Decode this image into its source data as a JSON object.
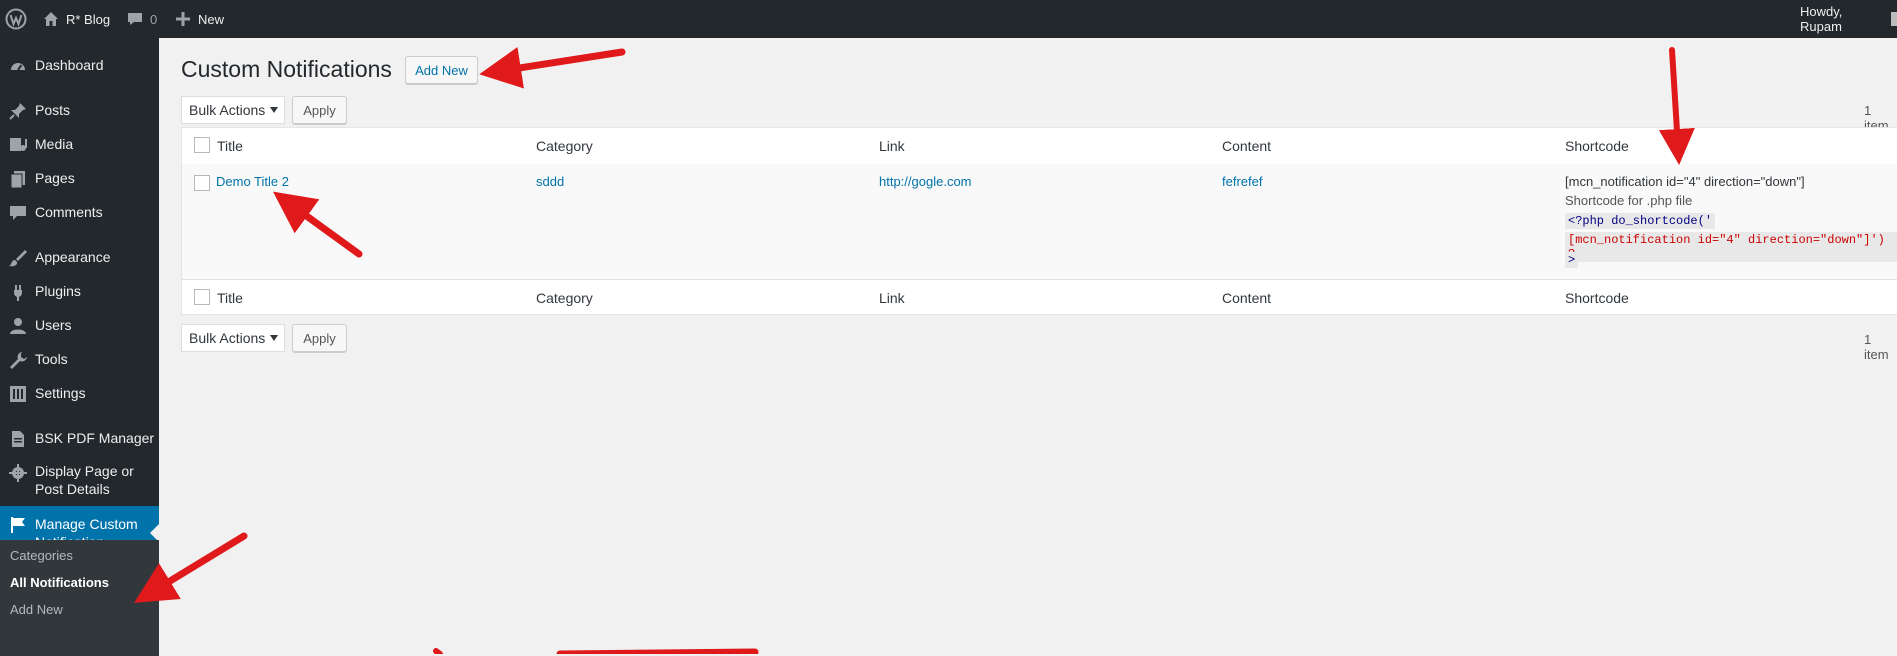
{
  "adminbar": {
    "site_name": "R* Blog",
    "comments_count": "0",
    "new_label": "New",
    "howdy": "Howdy, Rupam"
  },
  "sidebar": {
    "items": [
      {
        "label": "Dashboard",
        "icon": "dashboard-icon"
      },
      {
        "label": "Posts",
        "icon": "pushpin-icon"
      },
      {
        "label": "Media",
        "icon": "media-icon"
      },
      {
        "label": "Pages",
        "icon": "pages-icon"
      },
      {
        "label": "Comments",
        "icon": "comment-icon"
      },
      {
        "label": "Appearance",
        "icon": "paintbrush-icon"
      },
      {
        "label": "Plugins",
        "icon": "plug-icon"
      },
      {
        "label": "Users",
        "icon": "user-icon"
      },
      {
        "label": "Tools",
        "icon": "wrench-icon"
      },
      {
        "label": "Settings",
        "icon": "settings-icon"
      },
      {
        "label": "BSK PDF Manager",
        "icon": "document-icon"
      },
      {
        "label": "Display Page or Post Details",
        "icon": "gear-icon"
      },
      {
        "label": "Manage Custom Notification",
        "icon": "flag-icon"
      }
    ],
    "submenu": [
      "Categories",
      "All Notifications",
      "Add New"
    ]
  },
  "page": {
    "title": "Custom Notifications",
    "add_new": "Add New",
    "bulk_actions": "Bulk Actions",
    "apply": "Apply",
    "items_count": "1 item"
  },
  "table": {
    "columns": [
      "Title",
      "Category",
      "Link",
      "Content",
      "Shortcode"
    ],
    "rows": [
      {
        "title": "Demo Title 2",
        "category": "sddd",
        "link": "http://gogle.com",
        "content": "fefrefef",
        "shortcode": "[mcn_notification id=\"4\" direction=\"down\"]",
        "shortcode_php_label": "Shortcode for .php file",
        "php_line1": "<?php do_shortcode('",
        "php_line2": "[mcn_notification id=\"4\" direction=\"down\"]') ?",
        "php_line3": ">"
      }
    ]
  },
  "colors": {
    "adminbar": "#23282d",
    "sidebar": "#23282d",
    "active_menu": "#0073aa",
    "link": "#0073aa",
    "annotation_arrow": "#e0191b"
  }
}
